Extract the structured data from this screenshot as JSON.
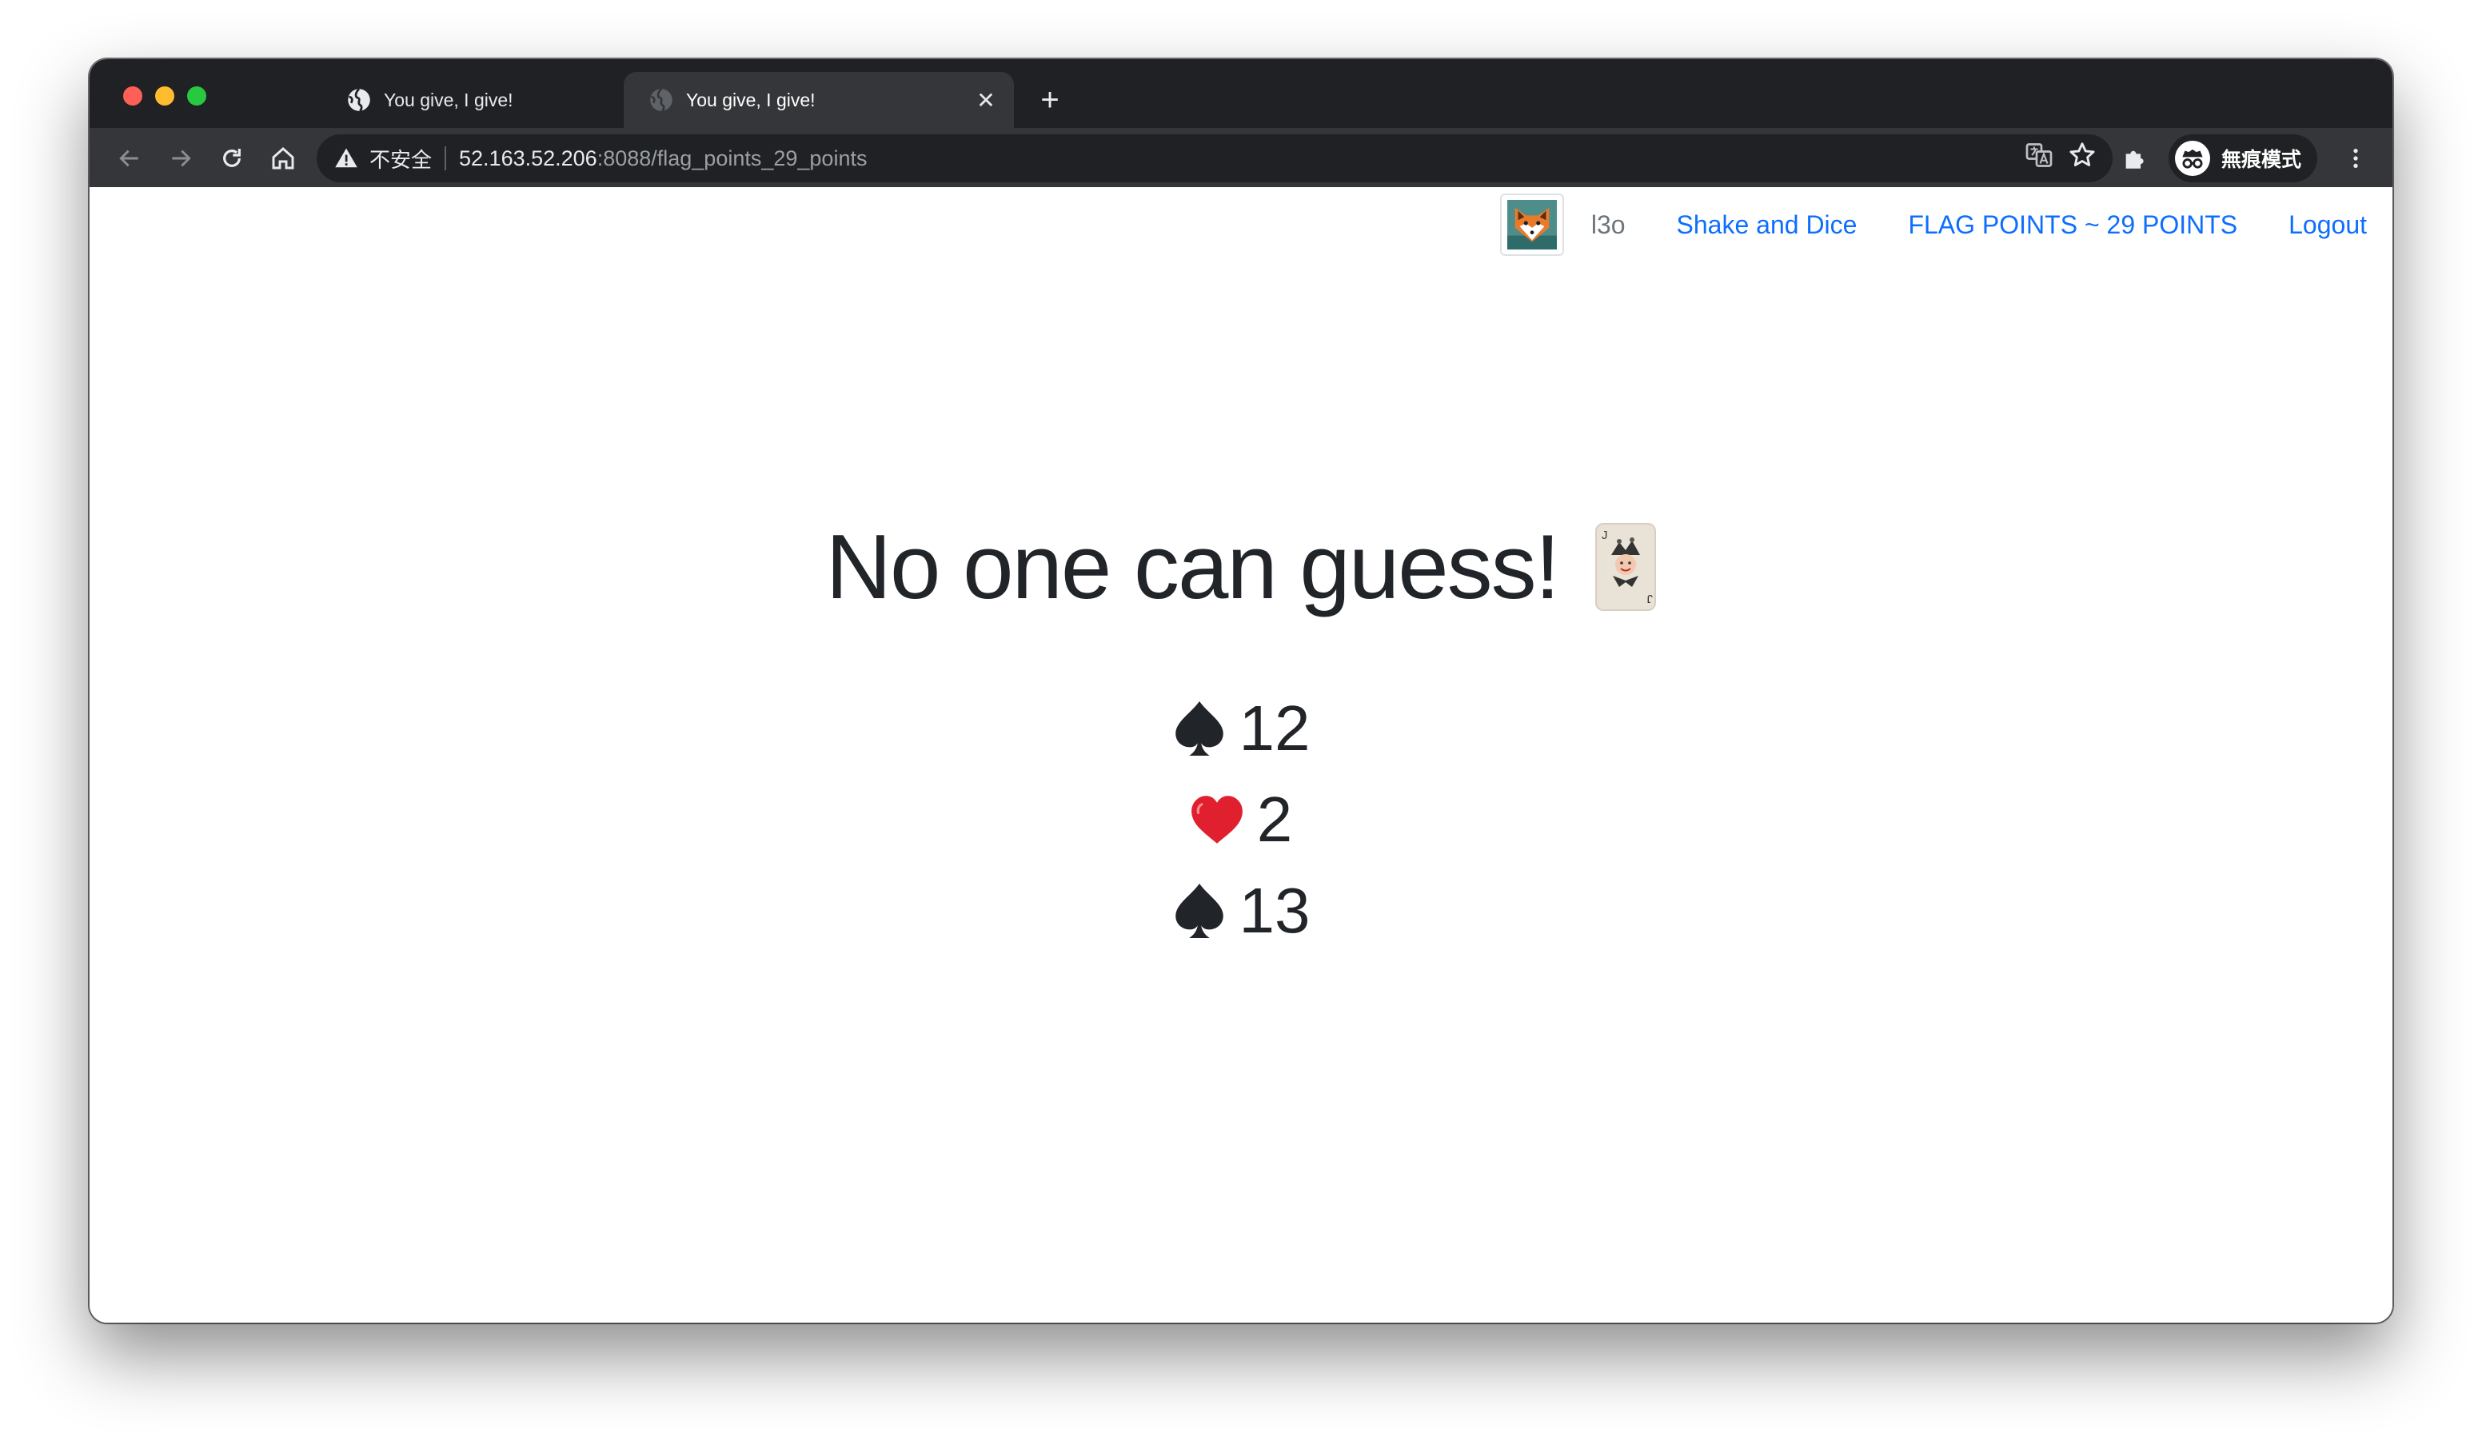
{
  "browser": {
    "tabs": [
      {
        "title": "You give, I give!",
        "active": false,
        "favicon": "globe-icon"
      },
      {
        "title": "You give, I give!",
        "active": true,
        "favicon": "globe-icon"
      }
    ],
    "address_bar": {
      "security_label": "不安全",
      "host": "52.163.52.206",
      "path": ":8088/flag_points_29_points"
    },
    "profile_label": "無痕模式"
  },
  "navbar": {
    "username": "l3o",
    "links": [
      "Shake and Dice",
      "FLAG POINTS ~ 29 POINTS",
      "Logout"
    ]
  },
  "main": {
    "headline": "No one can guess!",
    "cards": [
      {
        "suit": "spade",
        "value": "12",
        "color": "#212529"
      },
      {
        "suit": "heart",
        "value": "2",
        "color": "#e0202e"
      },
      {
        "suit": "spade",
        "value": "13",
        "color": "#212529"
      }
    ]
  },
  "colors": {
    "tab_strip": "#202124",
    "toolbar": "#35363a",
    "link": "#0d6efd",
    "text": "#212529"
  }
}
